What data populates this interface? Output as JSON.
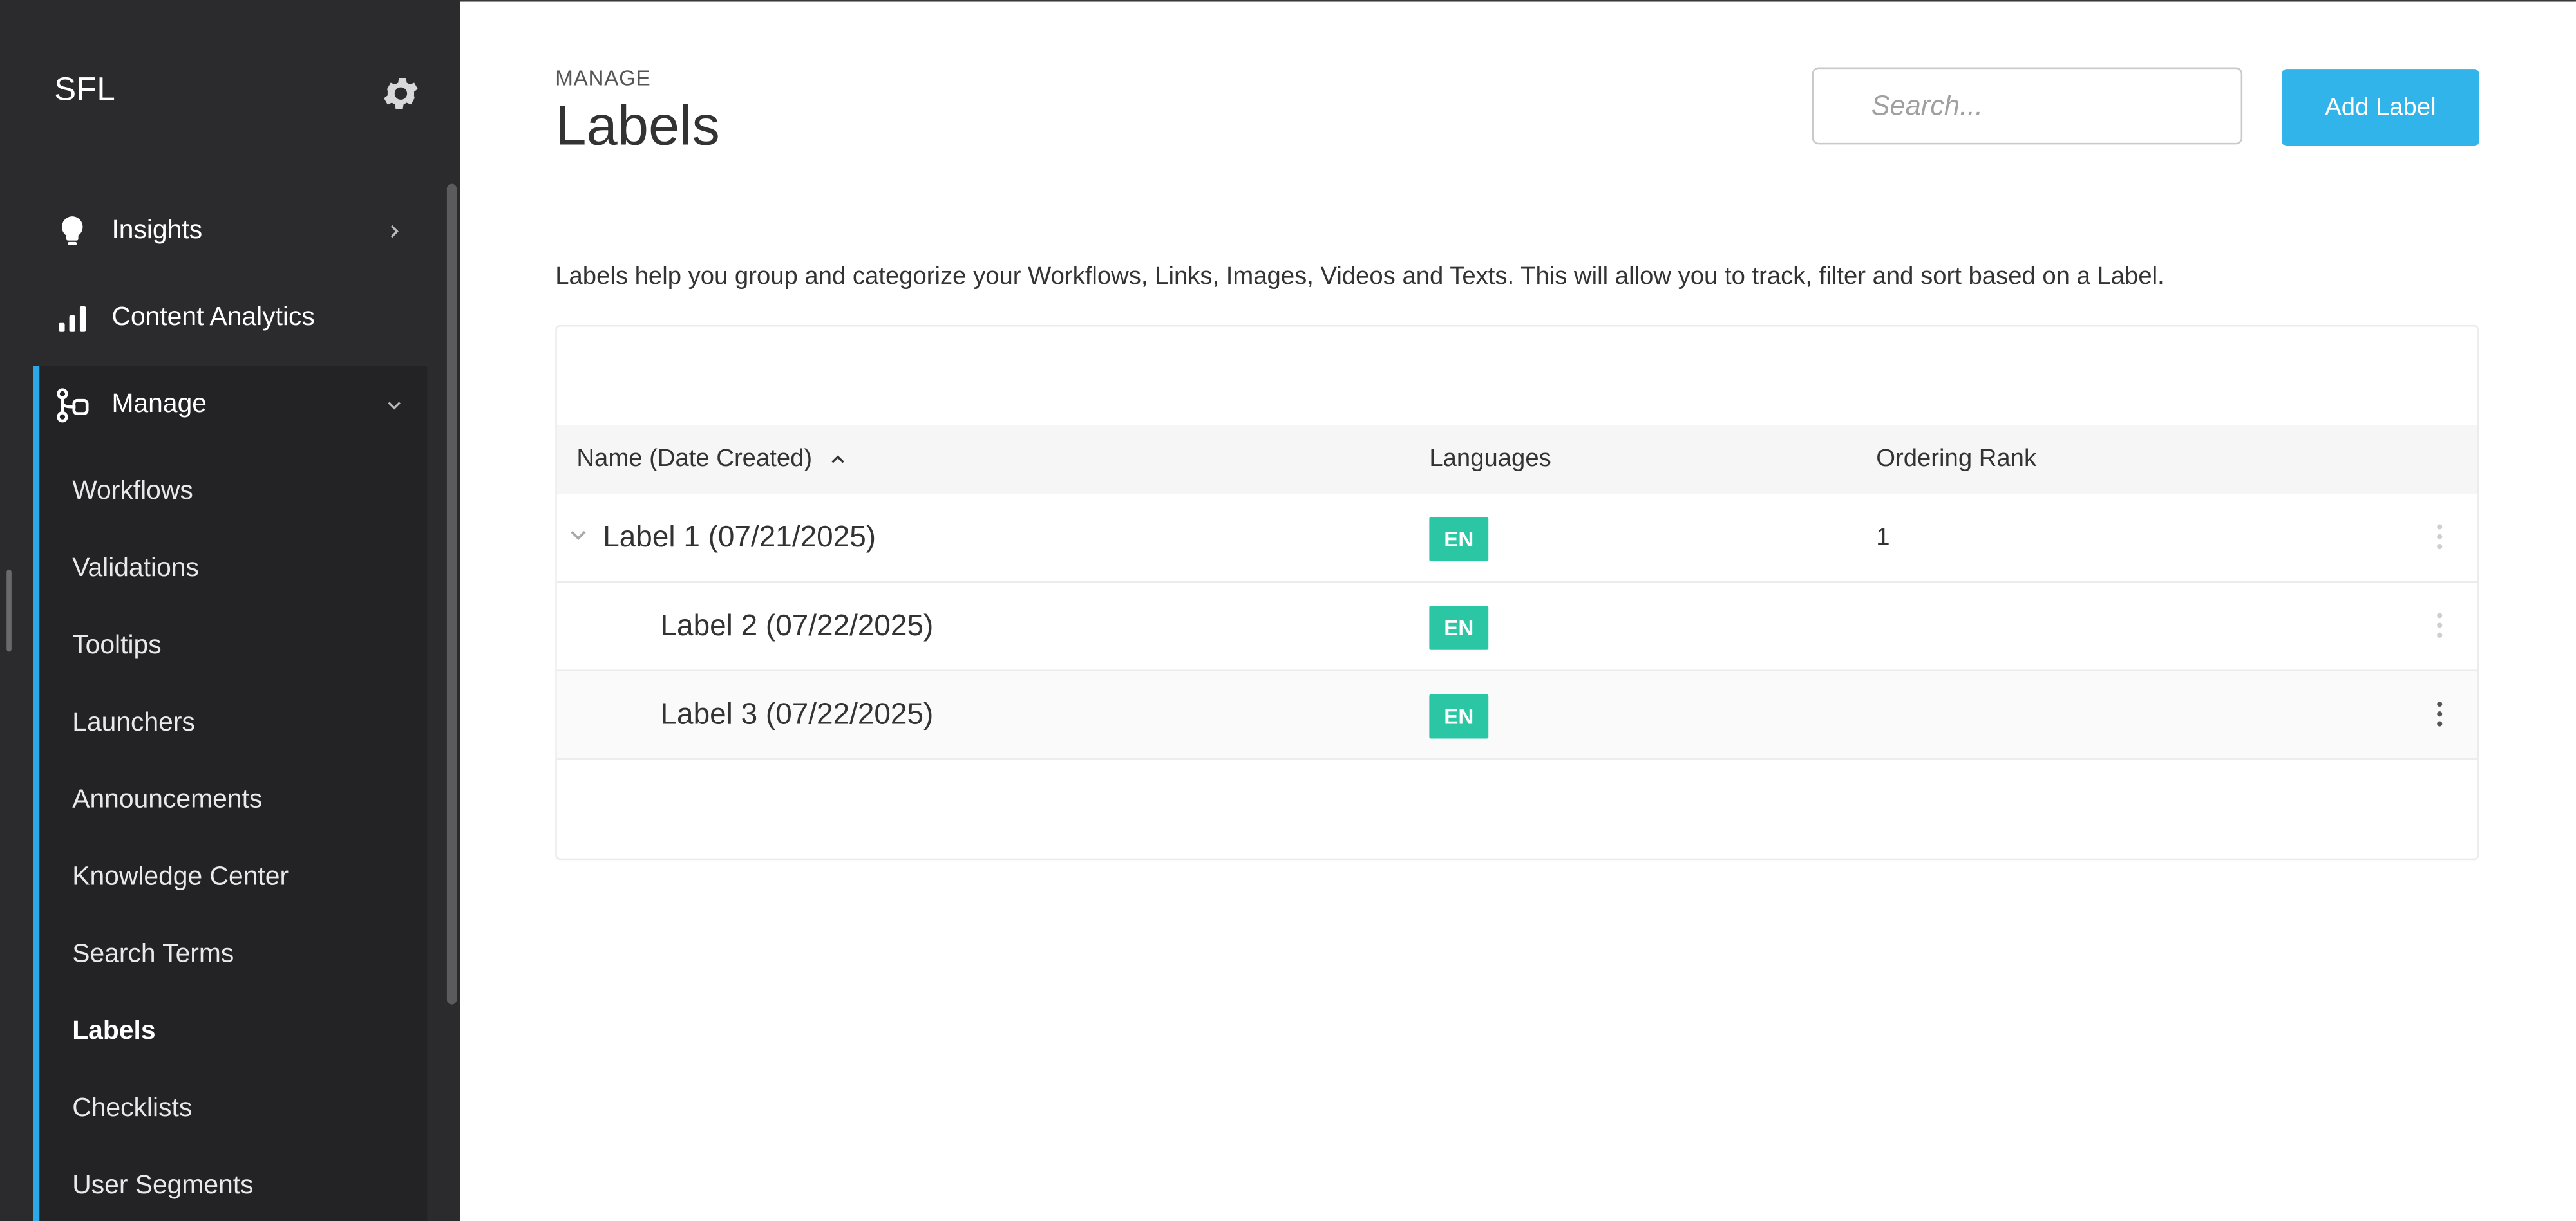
{
  "sidebar": {
    "title": "SFL",
    "settings_icon": "gear-icon",
    "items": [
      {
        "label": "Insights",
        "icon": "lightbulb-icon"
      },
      {
        "label": "Content Analytics",
        "icon": "bar-chart-icon"
      },
      {
        "label": "Manage",
        "icon": "manage-icon"
      }
    ],
    "manage_items": [
      "Workflows",
      "Validations",
      "Tooltips",
      "Launchers",
      "Announcements",
      "Knowledge Center",
      "Search Terms",
      "Labels",
      "Checklists",
      "User Segments"
    ],
    "active_item": "Labels",
    "accent_color": "#2aa9e6"
  },
  "header": {
    "kicker": "MANAGE",
    "title": "Labels",
    "search_placeholder": "Search...",
    "add_button_label": "Add Label",
    "add_button_color": "#31b4ea"
  },
  "description": "Labels help you group and categorize your Workflows, Links, Images, Videos and Texts. This will allow you to track, filter and sort based on a Label.",
  "table": {
    "columns": {
      "name": "Name (Date Created)",
      "languages": "Languages",
      "rank": "Ordering Rank"
    },
    "sort_icon": "sort-ascending-icon",
    "rows": [
      {
        "name": "Label 1 (07/21/2025)",
        "language": "EN",
        "rank": "1",
        "expandable": true
      },
      {
        "name": "Label 2 (07/22/2025)",
        "language": "EN",
        "rank": "",
        "expandable": false
      },
      {
        "name": "Label 3 (07/22/2025)",
        "language": "EN",
        "rank": "",
        "expandable": false
      }
    ],
    "badge_color": "#2bc6a4"
  }
}
